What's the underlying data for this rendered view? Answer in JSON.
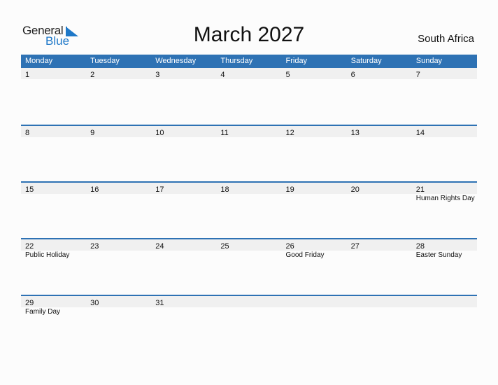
{
  "logo": {
    "general": "General",
    "blue": "Blue"
  },
  "title": "March 2027",
  "country": "South Africa",
  "colors": {
    "header": "#2e72b4",
    "band": "#f0f0f0",
    "logo_blue": "#1e78c8"
  },
  "weekdays": [
    "Monday",
    "Tuesday",
    "Wednesday",
    "Thursday",
    "Friday",
    "Saturday",
    "Sunday"
  ],
  "weeks": [
    [
      {
        "d": "1",
        "h": ""
      },
      {
        "d": "2",
        "h": ""
      },
      {
        "d": "3",
        "h": ""
      },
      {
        "d": "4",
        "h": ""
      },
      {
        "d": "5",
        "h": ""
      },
      {
        "d": "6",
        "h": ""
      },
      {
        "d": "7",
        "h": ""
      }
    ],
    [
      {
        "d": "8",
        "h": ""
      },
      {
        "d": "9",
        "h": ""
      },
      {
        "d": "10",
        "h": ""
      },
      {
        "d": "11",
        "h": ""
      },
      {
        "d": "12",
        "h": ""
      },
      {
        "d": "13",
        "h": ""
      },
      {
        "d": "14",
        "h": ""
      }
    ],
    [
      {
        "d": "15",
        "h": ""
      },
      {
        "d": "16",
        "h": ""
      },
      {
        "d": "17",
        "h": ""
      },
      {
        "d": "18",
        "h": ""
      },
      {
        "d": "19",
        "h": ""
      },
      {
        "d": "20",
        "h": ""
      },
      {
        "d": "21",
        "h": "Human Rights Day"
      }
    ],
    [
      {
        "d": "22",
        "h": "Public Holiday"
      },
      {
        "d": "23",
        "h": ""
      },
      {
        "d": "24",
        "h": ""
      },
      {
        "d": "25",
        "h": ""
      },
      {
        "d": "26",
        "h": "Good Friday"
      },
      {
        "d": "27",
        "h": ""
      },
      {
        "d": "28",
        "h": "Easter Sunday"
      }
    ],
    [
      {
        "d": "29",
        "h": "Family Day"
      },
      {
        "d": "30",
        "h": ""
      },
      {
        "d": "31",
        "h": ""
      },
      {
        "d": "",
        "h": ""
      },
      {
        "d": "",
        "h": ""
      },
      {
        "d": "",
        "h": ""
      },
      {
        "d": "",
        "h": ""
      }
    ]
  ]
}
